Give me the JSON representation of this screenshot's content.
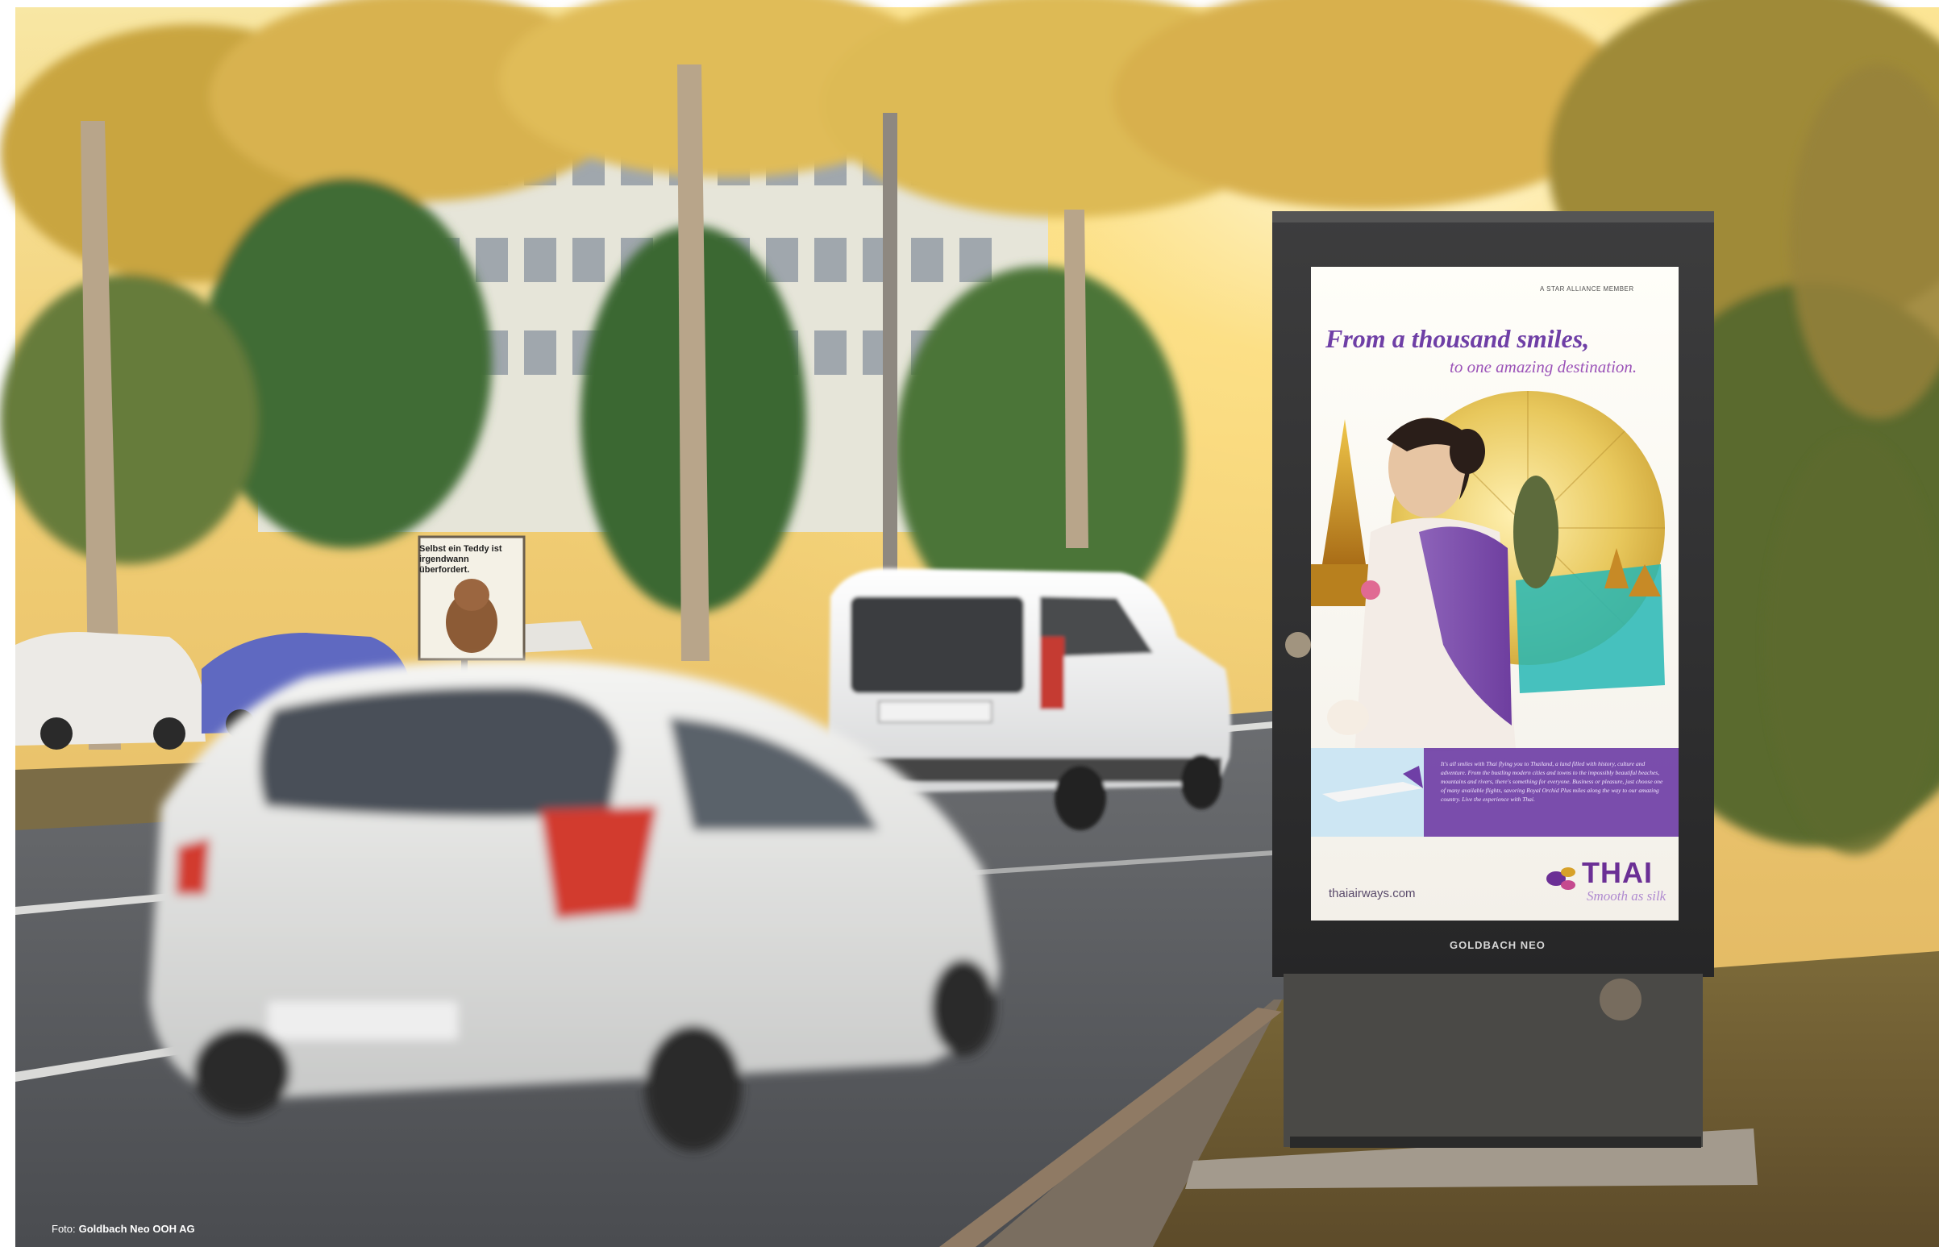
{
  "scene": {
    "street_sign": {
      "headline": "Selbst ein Teddy ist irgendwann überfordert."
    },
    "poster": {
      "star_alliance": "A STAR ALLIANCE MEMBER",
      "headline": "From a thousand smiles,",
      "subheadline": "to one amazing destination.",
      "body_copy": "It's all smiles with Thai flying you to Thailand, a land filled with history, culture and adventure. From the bustling modern cities and towns to the impossibly beautiful beaches, mountains and rivers, there's something for everyone. Business or pleasure, just choose one of many available flights, savoring Royal Orchid Plus miles along the way to our amazing country. Live the experience with Thai.",
      "website": "thaiairways.com",
      "logo_text": "THAI",
      "tagline": "Smooth as silk"
    },
    "kiosk_brand": "GOLDBACH NEO",
    "photo_credit_label": "Foto:",
    "photo_credit_name": "Goldbach Neo OOH AG"
  },
  "colors": {
    "poster_purple": "#6f3fa6",
    "poster_gold": "#e7b43c",
    "sunlight": "#f7d36a",
    "road_gray": "#5f6267"
  }
}
